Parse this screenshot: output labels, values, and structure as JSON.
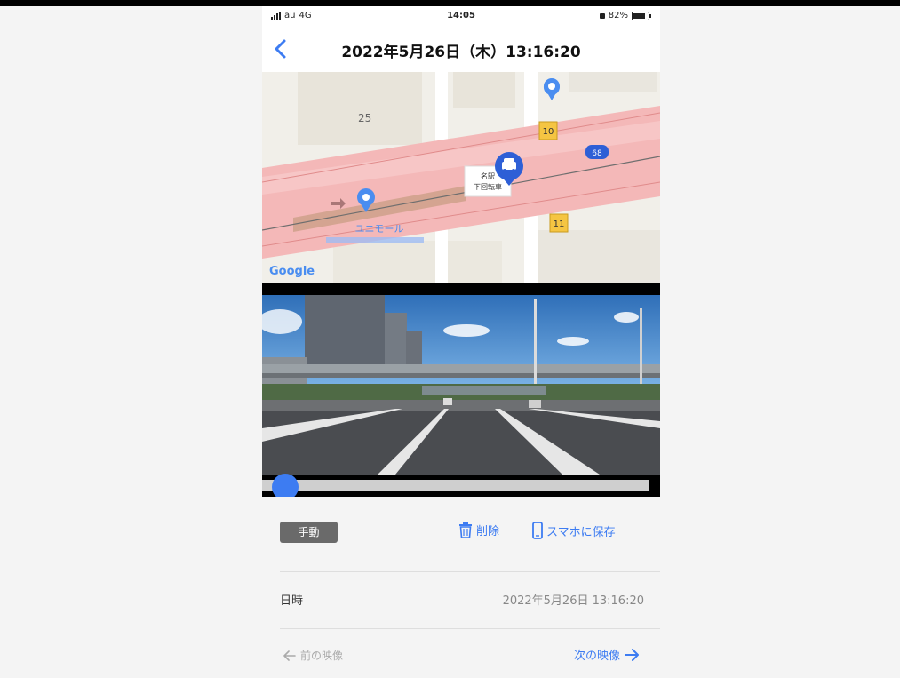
{
  "status_bar": {
    "carrier": "au",
    "network": "4G",
    "time": "14:05",
    "battery": "82%"
  },
  "nav": {
    "back_icon": "chevron-left-icon",
    "title": "2022年5月26日（木）13:16:20"
  },
  "map": {
    "block_number": "25",
    "route_shield_1": "10",
    "route_shield_2": "11",
    "route_badge": "68",
    "station_label_line1": "名駅",
    "station_label_line2": "下回転車",
    "mall_label": "ユニモール",
    "google_logo": "Google",
    "colors": {
      "road": "#f2b6b6",
      "route_shield": "#f5c542",
      "pin": "#4a8df0",
      "car_pin": "#2e5fd6"
    }
  },
  "video": {
    "playback_progress": 0
  },
  "info": {
    "badge": "手動",
    "delete_label": "削除",
    "save_label": "スマホに保存",
    "datetime_label": "日時",
    "datetime_value": "2022年5月26日 13:16:20",
    "prev_label": "前の映像",
    "next_label": "次の映像"
  },
  "accent_color": "#3d7cf2"
}
